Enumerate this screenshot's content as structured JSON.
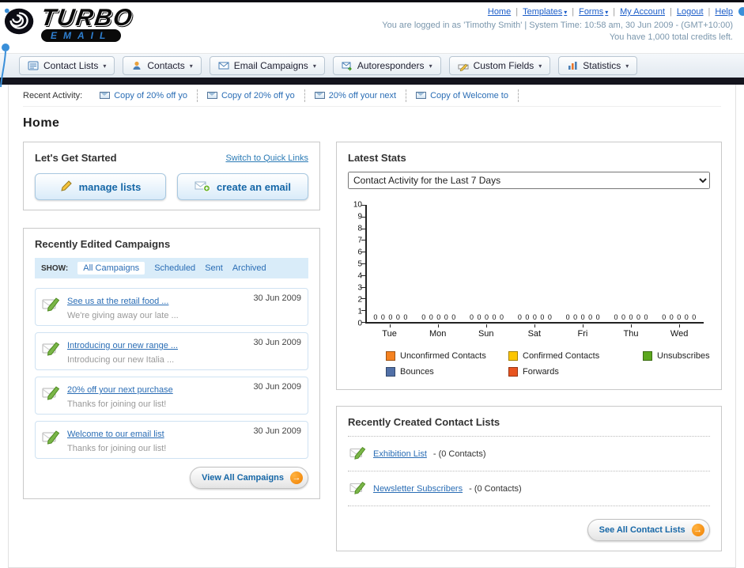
{
  "logo": {
    "word": "TURBO",
    "sub": "EMAIL"
  },
  "header": {
    "links": [
      "Home",
      "Templates",
      "Forms",
      "My Account",
      "Logout",
      "Help"
    ],
    "login_info": "You are logged in as 'Timothy Smith' | System Time: 10:58 am, 30 Jun 2009 - (GMT+10:00)",
    "credits_info": "You have 1,000 total credits left."
  },
  "nav": {
    "tabs": [
      {
        "label": "Contact Lists"
      },
      {
        "label": "Contacts"
      },
      {
        "label": "Email Campaigns"
      },
      {
        "label": "Autoresponders"
      },
      {
        "label": "Custom Fields"
      },
      {
        "label": "Statistics"
      }
    ]
  },
  "recent_activity": {
    "label": "Recent Activity:",
    "items": [
      "Copy of 20% off yo",
      "Copy of 20% off yo",
      "20% off your next",
      "Copy of Welcome to"
    ]
  },
  "page_title": "Home",
  "get_started": {
    "title": "Let's Get Started",
    "switch_link": "Switch to Quick Links",
    "manage_lists_label": "manage lists",
    "create_email_label": "create an email"
  },
  "campaigns": {
    "title": "Recently Edited Campaigns",
    "show_label": "SHOW:",
    "filters": [
      "All Campaigns",
      "Scheduled",
      "Sent",
      "Archived"
    ],
    "items": [
      {
        "title": "See us at the retail food ...",
        "subtitle": "We're giving away our late ...",
        "date": "30 Jun 2009"
      },
      {
        "title": "Introducing our new range ...",
        "subtitle": "Introducing our new Italia ...",
        "date": "30 Jun 2009"
      },
      {
        "title": "20% off your next purchase",
        "subtitle": "Thanks for joining our list!",
        "date": "30 Jun 2009"
      },
      {
        "title": "Welcome to our email list",
        "subtitle": "Thanks for joining our list!",
        "date": "30 Jun 2009"
      }
    ],
    "view_all_label": "View All Campaigns"
  },
  "stats": {
    "title": "Latest Stats",
    "dropdown_value": "Contact Activity for the Last 7 Days"
  },
  "chart_data": {
    "type": "bar",
    "title": "Contact Activity for the Last 7 Days",
    "categories": [
      "Tue",
      "Mon",
      "Sun",
      "Sat",
      "Fri",
      "Thu",
      "Wed"
    ],
    "series": [
      {
        "name": "Unconfirmed Contacts",
        "color": "#f58220",
        "values": [
          0,
          0,
          0,
          0,
          0,
          0,
          0
        ]
      },
      {
        "name": "Confirmed Contacts",
        "color": "#fdc600",
        "values": [
          0,
          0,
          0,
          0,
          0,
          0,
          0
        ]
      },
      {
        "name": "Unsubscribes",
        "color": "#5ca81e",
        "values": [
          0,
          0,
          0,
          0,
          0,
          0,
          0
        ]
      },
      {
        "name": "Bounces",
        "color": "#5170a7",
        "values": [
          0,
          0,
          0,
          0,
          0,
          0,
          0
        ]
      },
      {
        "name": "Forwards",
        "color": "#e85420",
        "values": [
          0,
          0,
          0,
          0,
          0,
          0,
          0
        ]
      }
    ],
    "ylim": [
      0,
      10
    ],
    "yticks": [
      0,
      1,
      2,
      3,
      4,
      5,
      6,
      7,
      8,
      9,
      10
    ],
    "grid": false,
    "legend_position": "bottom"
  },
  "contact_lists": {
    "title": "Recently Created Contact Lists",
    "items": [
      {
        "name": "Exhibition List",
        "detail": "- (0 Contacts)"
      },
      {
        "name": "Newsletter Subscribers",
        "detail": "- (0 Contacts)"
      }
    ],
    "see_all_label": "See All Contact Lists"
  }
}
